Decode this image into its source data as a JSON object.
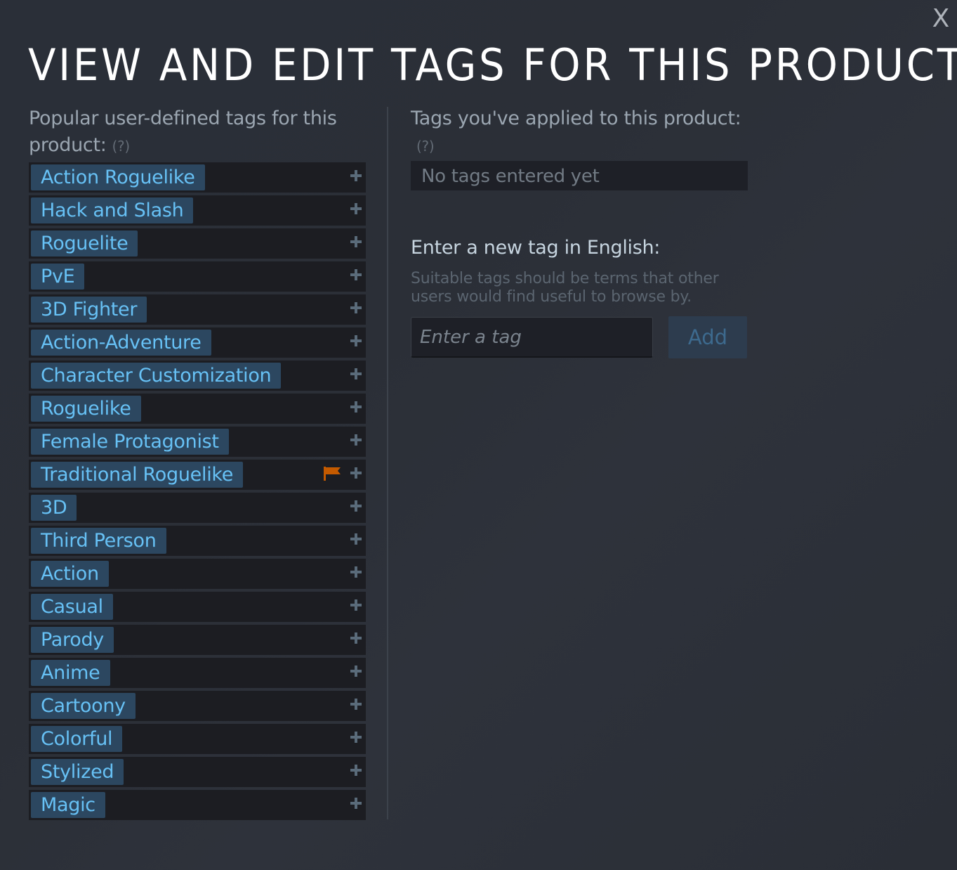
{
  "dialog": {
    "title": "VIEW AND EDIT TAGS FOR THIS PRODUCT",
    "close_label": "X"
  },
  "popular": {
    "label": "Popular user-defined tags for this product:",
    "help": "(?)",
    "tags": [
      {
        "label": "Action Roguelike",
        "flagged": false
      },
      {
        "label": "Hack and Slash",
        "flagged": false
      },
      {
        "label": "Roguelite",
        "flagged": false
      },
      {
        "label": "PvE",
        "flagged": false
      },
      {
        "label": "3D Fighter",
        "flagged": false
      },
      {
        "label": "Action-Adventure",
        "flagged": false
      },
      {
        "label": "Character Customization",
        "flagged": false
      },
      {
        "label": "Roguelike",
        "flagged": false
      },
      {
        "label": "Female Protagonist",
        "flagged": false
      },
      {
        "label": "Traditional Roguelike",
        "flagged": true
      },
      {
        "label": "3D",
        "flagged": false
      },
      {
        "label": "Third Person",
        "flagged": false
      },
      {
        "label": "Action",
        "flagged": false
      },
      {
        "label": "Casual",
        "flagged": false
      },
      {
        "label": "Parody",
        "flagged": false
      },
      {
        "label": "Anime",
        "flagged": false
      },
      {
        "label": "Cartoony",
        "flagged": false
      },
      {
        "label": "Colorful",
        "flagged": false
      },
      {
        "label": "Stylized",
        "flagged": false
      },
      {
        "label": "Magic",
        "flagged": false
      }
    ]
  },
  "applied": {
    "label": "Tags you've applied to this product:",
    "help": "(?)",
    "empty_text": "No tags entered yet"
  },
  "new_tag": {
    "label": "Enter a new tag in English:",
    "hint": "Suitable tags should be terms that other users would find useful to browse by.",
    "placeholder": "Enter a tag",
    "value": "",
    "add_label": "Add"
  },
  "colors": {
    "pill_bg": "#2c4760",
    "pill_text": "#67c1f5",
    "row_bg": "#1c1d22",
    "flag": "#c45a00"
  }
}
